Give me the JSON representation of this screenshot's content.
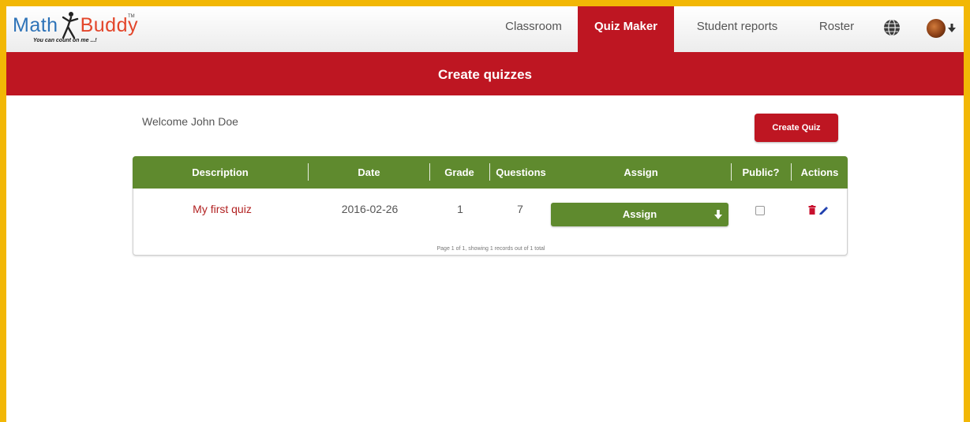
{
  "brand": {
    "name_part1": "Math",
    "name_part2": "Buddy",
    "trademark": "TM",
    "tagline": "You can count on me ...!"
  },
  "nav": {
    "items": [
      {
        "label": "Classroom",
        "active": false
      },
      {
        "label": "Quiz Maker",
        "active": true
      },
      {
        "label": "Student reports",
        "active": false
      },
      {
        "label": "Roster",
        "active": false
      }
    ],
    "icons": [
      "globe-icon",
      "user-avatar",
      "caret-down-icon"
    ]
  },
  "banner": {
    "title": "Create quizzes"
  },
  "welcome": {
    "text": "Welcome John Doe"
  },
  "create_button": {
    "label": "Create Quiz"
  },
  "table": {
    "headers": [
      "Description",
      "Date",
      "Grade",
      "Questions",
      "Assign",
      "Public?",
      "Actions"
    ],
    "rows": [
      {
        "description": "My first quiz",
        "date": "2016-02-26",
        "grade": "1",
        "questions": "7",
        "assign": "Assign",
        "public": false,
        "actions": [
          "trash-icon",
          "pencil-icon"
        ]
      }
    ],
    "pager": "Page 1 of 1, showing 1 records out of 1 total"
  },
  "colors": {
    "frame": "#f2b705",
    "brand_red": "#be1622",
    "table_green": "#5f8a2e",
    "link_red": "#b22222"
  }
}
